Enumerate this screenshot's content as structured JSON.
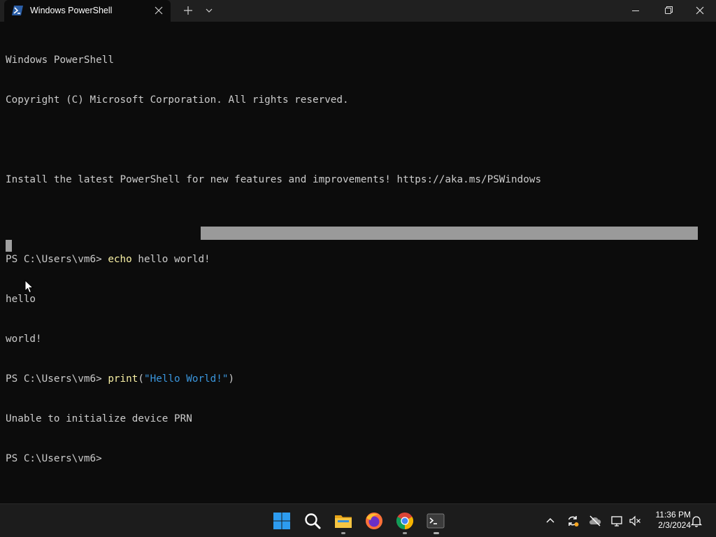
{
  "window": {
    "tab_title": "Windows PowerShell"
  },
  "terminal": {
    "lines": [
      {
        "text": "Windows PowerShell"
      },
      {
        "text": "Copyright (C) Microsoft Corporation. All rights reserved."
      },
      {
        "text": ""
      },
      {
        "text": "Install the latest PowerShell for new features and improvements! https://aka.ms/PSWindows"
      },
      {
        "text": ""
      },
      {
        "prompt": "PS C:\\Users\\vm6> ",
        "cmd": "echo",
        "rest": " hello world!"
      },
      {
        "text": "hello"
      },
      {
        "text": "world!"
      },
      {
        "prompt": "PS C:\\Users\\vm6> ",
        "cmd": "print",
        "rest": "(",
        "str": "\"Hello World!\"",
        "rest2": ")"
      },
      {
        "text": "Unable to initialize device PRN"
      },
      {
        "text": "PS C:\\Users\\vm6>"
      }
    ]
  },
  "taskbar": {
    "apps": [
      {
        "name": "start-icon"
      },
      {
        "name": "search-icon"
      },
      {
        "name": "file-explorer-icon"
      },
      {
        "name": "firefox-icon"
      },
      {
        "name": "chrome-icon"
      },
      {
        "name": "terminal-icon"
      }
    ],
    "clock": {
      "time": "11:36 PM",
      "date": "2/3/2024"
    }
  },
  "colors": {
    "background": "#0c0c0c",
    "text": "#cccccc",
    "command": "#f9f1a5",
    "string": "#3a96dd",
    "titlebar": "#202020",
    "taskbar": "#1c1c1c"
  }
}
